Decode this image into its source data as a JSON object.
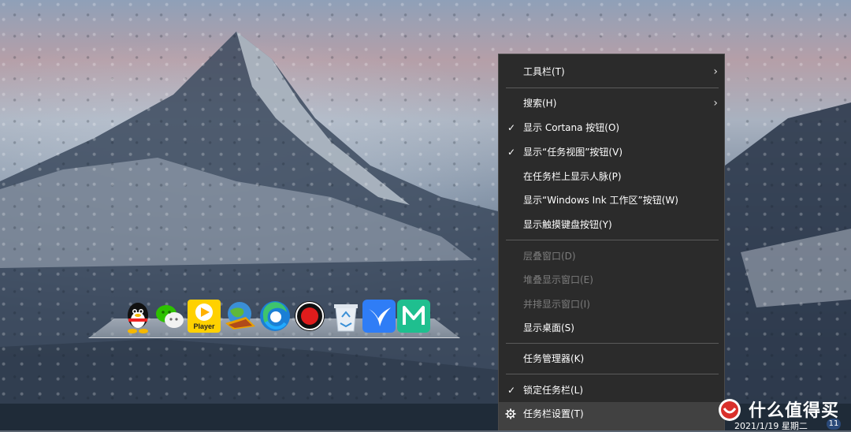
{
  "context_menu": {
    "items": [
      {
        "label": "工具栏(T)",
        "submenu": true,
        "checked": false,
        "disabled": false
      },
      {
        "label": "搜索(H)",
        "submenu": true,
        "checked": false,
        "disabled": false
      },
      {
        "label": "显示 Cortana 按钮(O)",
        "submenu": false,
        "checked": true,
        "disabled": false
      },
      {
        "label": "显示“任务视图”按钮(V)",
        "submenu": false,
        "checked": true,
        "disabled": false
      },
      {
        "label": "在任务栏上显示人脉(P)",
        "submenu": false,
        "checked": false,
        "disabled": false
      },
      {
        "label": "显示“Windows Ink 工作区”按钮(W)",
        "submenu": false,
        "checked": false,
        "disabled": false
      },
      {
        "label": "显示触摸键盘按钮(Y)",
        "submenu": false,
        "checked": false,
        "disabled": false
      },
      {
        "label": "层叠窗口(D)",
        "submenu": false,
        "checked": false,
        "disabled": true
      },
      {
        "label": "堆叠显示窗口(E)",
        "submenu": false,
        "checked": false,
        "disabled": true
      },
      {
        "label": "并排显示窗口(I)",
        "submenu": false,
        "checked": false,
        "disabled": true
      },
      {
        "label": "显示桌面(S)",
        "submenu": false,
        "checked": false,
        "disabled": false
      },
      {
        "label": "任务管理器(K)",
        "submenu": false,
        "checked": false,
        "disabled": false
      },
      {
        "label": "锁定任务栏(L)",
        "submenu": false,
        "checked": true,
        "disabled": false
      },
      {
        "label": "任务栏设置(T)",
        "submenu": false,
        "checked": false,
        "disabled": false,
        "icon": "gear-icon",
        "highlighted": true
      }
    ]
  },
  "dock": {
    "icons": [
      "qq-icon",
      "wechat-icon",
      "potplayer-icon",
      "internet-download-icon",
      "edge-icon",
      "record-icon",
      "recycle-bin-icon",
      "feishu-icon",
      "mindmaster-icon"
    ],
    "player_label": "Player"
  },
  "tray": {
    "date": "2021/1/19 星期二",
    "notification_count": "11"
  },
  "watermark": {
    "text": "什么值得买",
    "logo": "smzdm-logo"
  },
  "colors": {
    "menu_bg": "#2b2b2b",
    "taskbar_bg": "#1f2b38",
    "disabled_text": "#7c7c7c"
  }
}
